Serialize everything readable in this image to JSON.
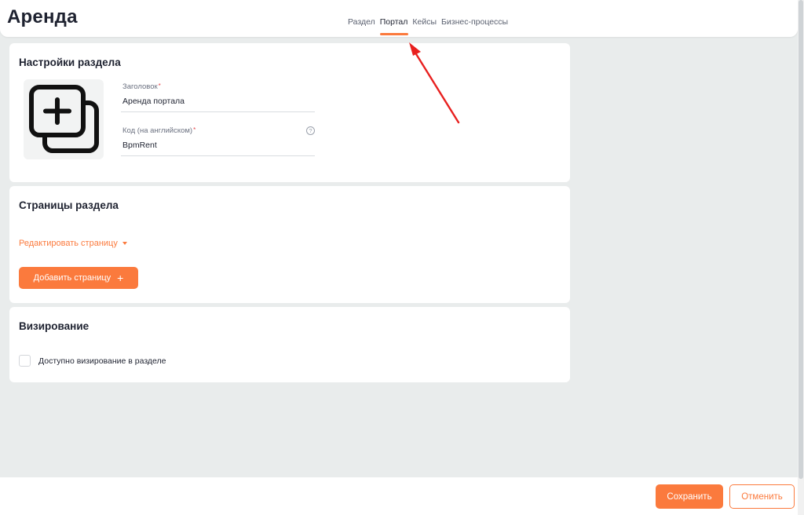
{
  "header": {
    "title": "Аренда",
    "tabs": [
      {
        "label": "Раздел",
        "active": false
      },
      {
        "label": "Портал",
        "active": true
      },
      {
        "label": "Кейсы",
        "active": false
      },
      {
        "label": "Бизнес-процессы",
        "active": false
      }
    ]
  },
  "settings": {
    "title": "Настройки раздела",
    "icon": "copy-plus-icon",
    "fields": [
      {
        "label": "Заголовок",
        "required": "*",
        "value": "Аренда портала"
      },
      {
        "label": "Код (на английском)",
        "required": "*",
        "value": "BpmRent",
        "help": "?"
      }
    ]
  },
  "pages": {
    "title": "Страницы раздела",
    "edit_label": "Редактировать страницу",
    "add_label": "Добавить страницу",
    "add_icon": "+"
  },
  "approval": {
    "title": "Визирование",
    "checkbox_label": "Доступно визирование в разделе",
    "checked": false
  },
  "footer": {
    "save_label": "Сохранить",
    "cancel_label": "Отменить"
  },
  "colors": {
    "accent": "#fb7a3d",
    "annotation_arrow": "#e8201f",
    "background": "#e9ecec"
  }
}
